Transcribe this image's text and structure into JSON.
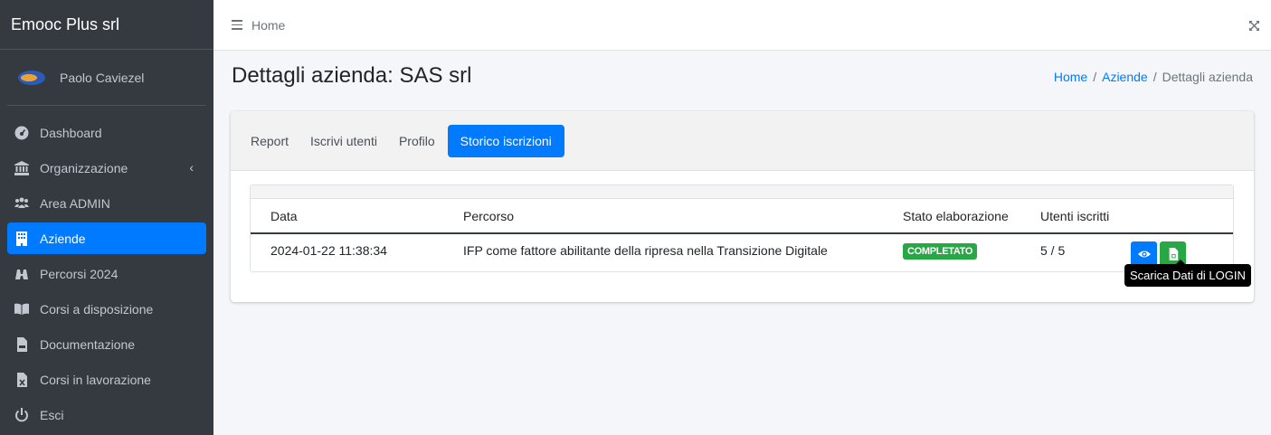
{
  "sidebar": {
    "brand": "Emooc Plus srl",
    "user_name": "Paolo Caviezel",
    "items": [
      {
        "label": "Dashboard",
        "icon": "dashboard-icon"
      },
      {
        "label": "Organizzazione",
        "icon": "bank-icon"
      },
      {
        "label": "Area ADMIN",
        "icon": "users-icon"
      },
      {
        "label": "Aziende",
        "icon": "building-icon",
        "active": true
      },
      {
        "label": "Percorsi 2024",
        "icon": "binoculars-icon"
      },
      {
        "label": "Corsi a disposizione",
        "icon": "book-icon"
      },
      {
        "label": "Documentazione",
        "icon": "pdf-file-icon"
      },
      {
        "label": "Corsi in lavorazione",
        "icon": "excel-file-icon"
      },
      {
        "label": "Esci",
        "icon": "power-icon"
      }
    ],
    "chevron": "‹"
  },
  "topbar": {
    "home_label": "Home"
  },
  "header": {
    "title": "Dettagli azienda: SAS srl",
    "breadcrumb": [
      "Home",
      "Aziende",
      "Dettagli azienda"
    ]
  },
  "tabs": [
    {
      "label": "Report"
    },
    {
      "label": "Iscrivi utenti"
    },
    {
      "label": "Profilo"
    },
    {
      "label": "Storico iscrizioni",
      "active": true
    }
  ],
  "table": {
    "columns": [
      "Data",
      "Percorso",
      "Stato elaborazione",
      "Utenti iscritti",
      ""
    ],
    "rows": [
      {
        "data": "2024-01-22 11:38:34",
        "percorso": "IFP come fattore abilitante della ripresa nella Transizione Digitale",
        "stato": "COMPLETATO",
        "utenti": "5 / 5"
      }
    ]
  },
  "tooltip": "Scarica Dati di LOGIN",
  "colors": {
    "sidebar_bg": "#343a40",
    "primary": "#007bff",
    "success": "#28a745"
  }
}
